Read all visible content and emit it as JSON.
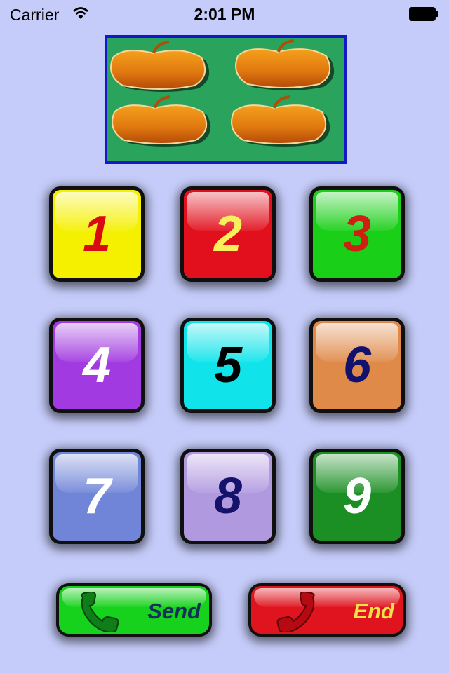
{
  "status_bar": {
    "carrier": "Carrier",
    "time": "2:01 PM",
    "wifi_icon": "wifi-icon",
    "battery_icon": "battery-icon"
  },
  "picture": {
    "subject": "apples",
    "background_color": "#2aa35c",
    "border_color": "#1317c8"
  },
  "keys": [
    {
      "label": "1",
      "bg": "#f5f000",
      "fg": "#d80a12"
    },
    {
      "label": "2",
      "bg": "#e20f1c",
      "fg": "#f7f05a"
    },
    {
      "label": "3",
      "bg": "#19cf17",
      "fg": "#cf1f13"
    },
    {
      "label": "4",
      "bg": "#a13ae0",
      "fg": "#ffffff"
    },
    {
      "label": "5",
      "bg": "#10e4ea",
      "fg": "#000000"
    },
    {
      "label": "6",
      "bg": "#df8a48",
      "fg": "#11116e"
    },
    {
      "label": "7",
      "bg": "#7085d8",
      "fg": "#ffffff"
    },
    {
      "label": "8",
      "bg": "#b199e0",
      "fg": "#14126a"
    },
    {
      "label": "9",
      "bg": "#1c8f24",
      "fg": "#ffffff"
    }
  ],
  "call_buttons": {
    "send": {
      "label": "Send",
      "icon": "phone-handset-icon",
      "bg": "#17d21c",
      "fg": "#14305a"
    },
    "end": {
      "label": "End",
      "icon": "phone-handset-icon",
      "bg": "#e0141e",
      "fg": "#f2e24a"
    }
  }
}
